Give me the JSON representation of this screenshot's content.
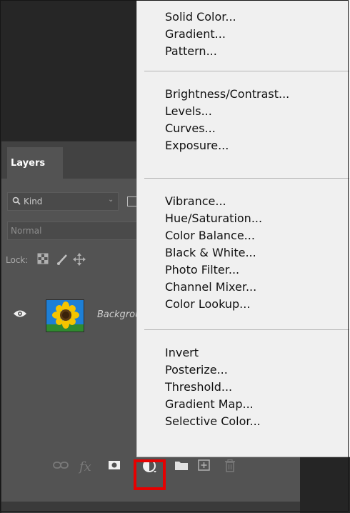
{
  "menu": {
    "groups": [
      {
        "items": [
          "Solid Color...",
          "Gradient...",
          "Pattern..."
        ]
      },
      {
        "items": [
          "Brightness/Contrast...",
          "Levels...",
          "Curves...",
          "Exposure..."
        ]
      },
      {
        "items": [
          "Vibrance...",
          "Hue/Saturation...",
          "Color Balance...",
          "Black & White...",
          "Photo Filter...",
          "Channel Mixer...",
          "Color Lookup..."
        ]
      },
      {
        "items": [
          "Invert",
          "Posterize...",
          "Threshold...",
          "Gradient Map...",
          "Selective Color..."
        ]
      }
    ]
  },
  "layers_panel": {
    "tab_label": "Layers",
    "kind_filter": "Kind",
    "blend_mode": "Normal",
    "lock_label": "Lock:",
    "layer": {
      "name": "Background",
      "visible": true
    }
  },
  "footer_icons": [
    "link-icon",
    "fx-icon",
    "layer-mask-icon",
    "adjustment-layer-icon",
    "group-folder-icon",
    "new-layer-icon",
    "trash-icon"
  ],
  "colors": {
    "panel_bg": "#535353",
    "menu_bg": "#f0f0f0",
    "highlight": "#e60000"
  }
}
